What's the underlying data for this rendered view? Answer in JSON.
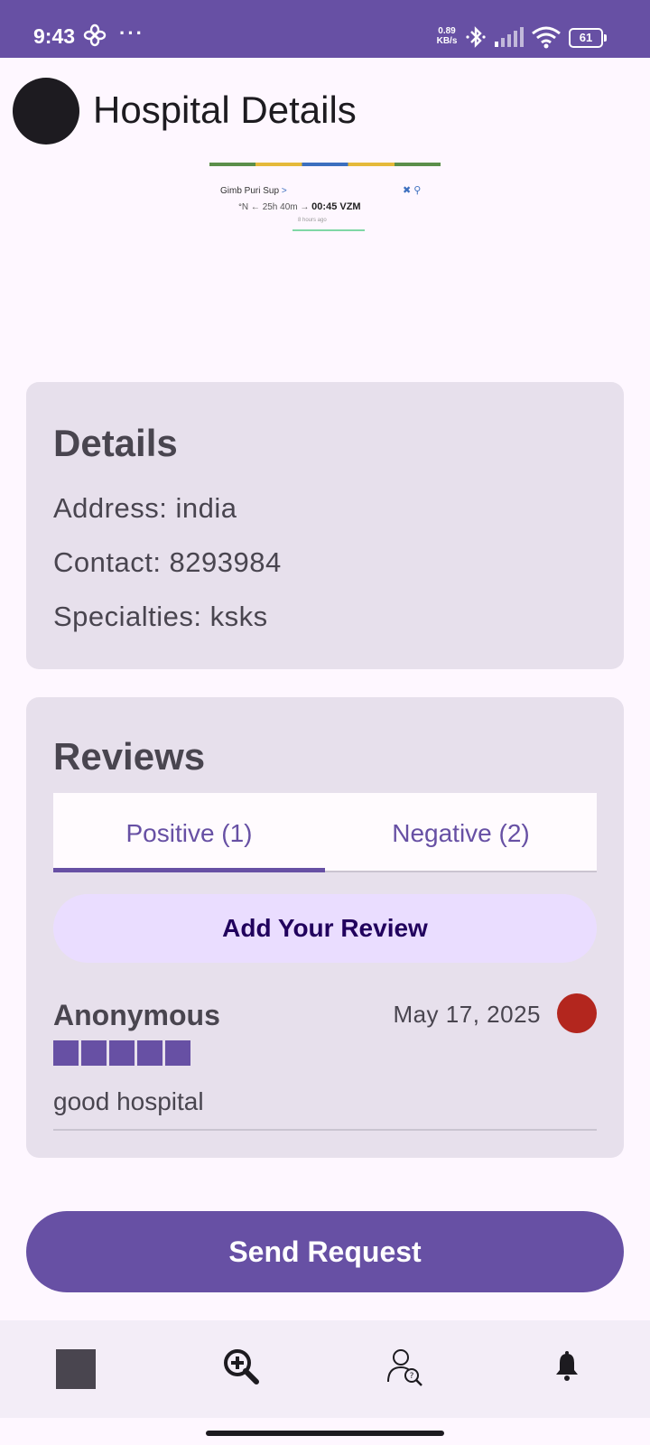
{
  "status_bar": {
    "time": "9:43",
    "dots": "···",
    "speed_value": "0.89",
    "speed_unit": "KB/s",
    "battery": "61"
  },
  "header": {
    "title": "Hospital Details"
  },
  "thumbnail": {
    "route": "Gimb Puri Sup",
    "chevron": ">",
    "origin_partial": "ᐤN",
    "duration": "25h 40m",
    "arrival": "00:45 VZM",
    "ago": "8 hours ago",
    "tools": "✖ ⚲"
  },
  "details": {
    "title": "Details",
    "address": "Address: india",
    "contact": "Contact: 8293984",
    "specialties": "Specialties: ksks"
  },
  "reviews": {
    "title": "Reviews",
    "tabs": [
      {
        "label": "Positive (1)",
        "selected": true
      },
      {
        "label": "Negative (2)",
        "selected": false
      }
    ],
    "add_label": "Add Your Review",
    "items": [
      {
        "author": "Anonymous",
        "date": "May 17, 2025",
        "rating": 5,
        "rating_max": 5,
        "text": "good hospital"
      }
    ]
  },
  "actions": {
    "send_label": "Send Request"
  },
  "nav": {
    "items": [
      {
        "icon": "home-square-icon"
      },
      {
        "icon": "search-hospital-icon"
      },
      {
        "icon": "find-doctor-icon"
      },
      {
        "icon": "notification-bell-icon"
      }
    ]
  },
  "colors": {
    "primary": "#6750A4",
    "surface_variant": "#E7E0EC",
    "background": "#FEF7FF",
    "error": "#B3261E",
    "primary_container": "#EADDFF"
  }
}
